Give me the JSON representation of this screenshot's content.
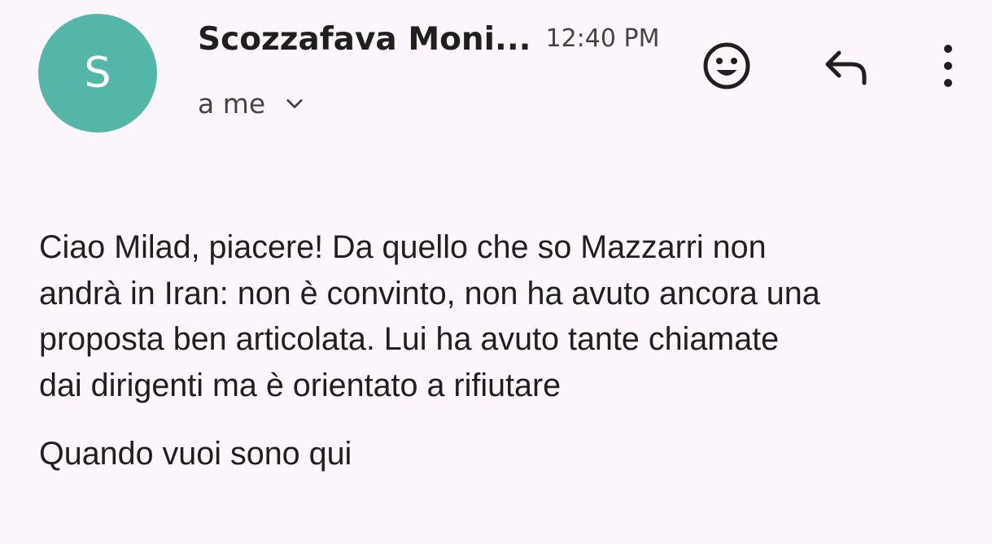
{
  "email": {
    "sender_initial": "S",
    "sender_name": "Scozzafava Moni...",
    "time": "12:40 PM",
    "recipient": "a me",
    "body": {
      "paragraph1_lines": [
        "Ciao Milad, piacere! Da quello che so Mazzarri non",
        "andrà in Iran: non è convinto, non ha avuto ancora una",
        "proposta ben articolata. Lui ha avuto tante chiamate",
        "dai dirigenti ma è orientato a rifiutare"
      ],
      "paragraph2": "Quando vuoi sono qui"
    }
  },
  "actions": {
    "react_icon": "smiley-icon",
    "reply_icon": "reply-icon",
    "more_icon": "more-vertical-icon",
    "recipient_expand_icon": "chevron-down-icon"
  },
  "colors": {
    "background": "#fcf5fc",
    "avatar": "#53b6a8",
    "text": "#1f1f1f",
    "secondary_text": "#444444"
  }
}
